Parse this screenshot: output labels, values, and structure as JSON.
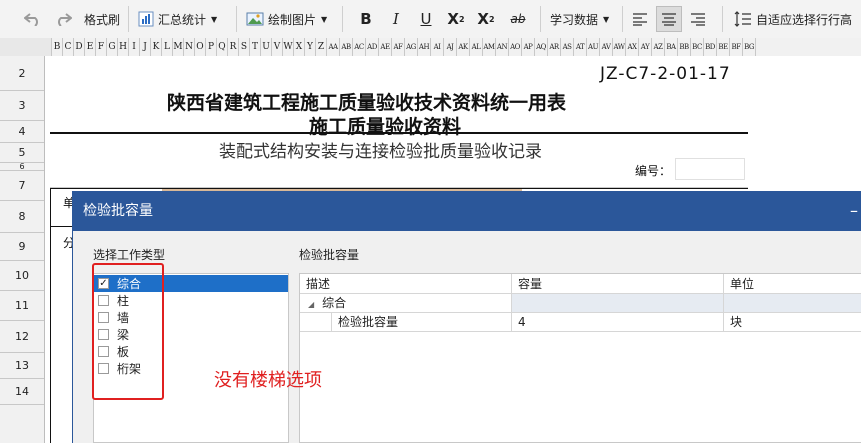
{
  "toolbar": {
    "format_painter": "格式刷",
    "summary_stats": "汇总统计",
    "draw_picture": "绘制图片",
    "bold": "B",
    "italic": "I",
    "underline": "U",
    "superscript": "X",
    "superscript_mark": "2",
    "subscript": "X",
    "subscript_mark": "2",
    "strikethrough": "ab",
    "learn_data": "学习数据",
    "autofit_row_height": "自适应选择行行高"
  },
  "columns": [
    "B",
    "C",
    "D",
    "E",
    "F",
    "G",
    "H",
    "I",
    "J",
    "K",
    "L",
    "M",
    "N",
    "O",
    "P",
    "Q",
    "R",
    "S",
    "T",
    "U",
    "V",
    "W",
    "X",
    "Y",
    "Z",
    "AA",
    "AB",
    "AC",
    "AD",
    "AE",
    "AF",
    "AG",
    "AH",
    "AI",
    "AJ",
    "AK",
    "AL",
    "AM",
    "AN",
    "AO",
    "AP",
    "AQ",
    "AR",
    "AS",
    "AT",
    "AU",
    "AV",
    "AW",
    "AX",
    "AY",
    "AZ",
    "BA",
    "BB",
    "BC",
    "BD",
    "BE",
    "BF",
    "BG"
  ],
  "rows": [
    "2",
    "3",
    "4",
    "5",
    "6",
    "7",
    "8",
    "9",
    "10",
    "11",
    "12",
    "13",
    "14"
  ],
  "sheet": {
    "form_code": "JZ-C7-2-01-17",
    "title_line1": "陕西省建筑工程施工质量验收技术资料统一用表",
    "title_line2": "施工质量验收资料",
    "subtitle": "装配式结构安装与连接检验批质量验收记录",
    "number_label": "编号：",
    "row7_text": "单",
    "row8_text": "分"
  },
  "dialog": {
    "title": "检验批容量",
    "minimize": "–",
    "left_label": "选择工作类型",
    "right_label": "检验批容量",
    "work_types": [
      {
        "label": "综合",
        "checked": true,
        "selected": true
      },
      {
        "label": "柱",
        "checked": false,
        "selected": false
      },
      {
        "label": "墙",
        "checked": false,
        "selected": false
      },
      {
        "label": "梁",
        "checked": false,
        "selected": false
      },
      {
        "label": "板",
        "checked": false,
        "selected": false
      },
      {
        "label": "桁架",
        "checked": false,
        "selected": false
      }
    ],
    "grid": {
      "headers": [
        "描述",
        "容量",
        "单位"
      ],
      "group": "综合",
      "rows": [
        {
          "desc": "检验批容量",
          "capacity": "4",
          "unit": "块"
        }
      ]
    }
  },
  "annotation": "没有楼梯选项",
  "colors": {
    "dialog_title_bg": "#2b579a",
    "selection": "#1e6fc8",
    "annotation_red": "#e02020"
  }
}
